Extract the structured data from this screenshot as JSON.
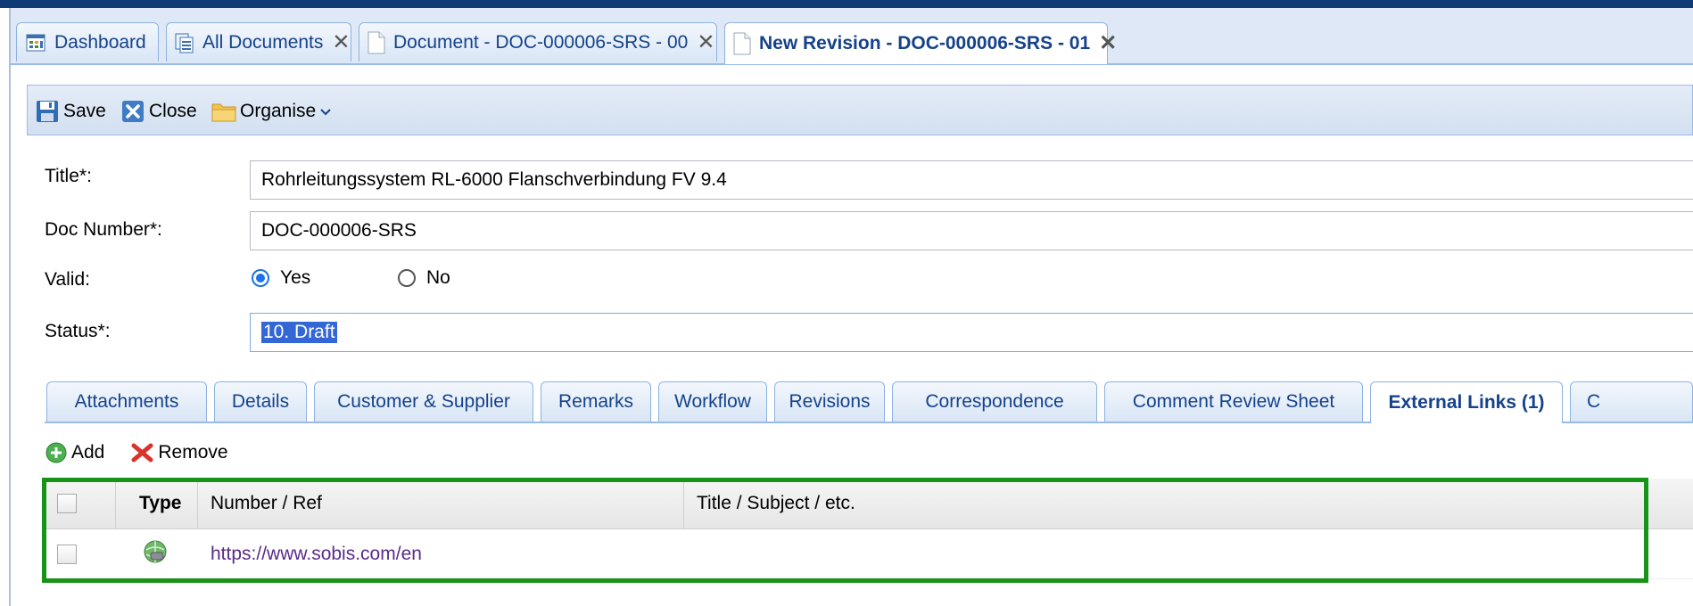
{
  "tabs": [
    {
      "label": "Dashboard",
      "icon": "dashboard-icon",
      "closable": false,
      "active": false
    },
    {
      "label": "All Documents",
      "icon": "documents-icon",
      "closable": true,
      "active": false
    },
    {
      "label": "Document - DOC-000006-SRS - 00",
      "icon": "document-icon",
      "closable": true,
      "active": false
    },
    {
      "label": "New Revision - DOC-000006-SRS - 01",
      "icon": "document-icon",
      "closable": true,
      "active": true
    }
  ],
  "toolbar": {
    "save_label": "Save",
    "close_label": "Close",
    "organise_label": "Organise"
  },
  "form": {
    "title_label": "Title*:",
    "title_value": "Rohrleitungssystem RL-6000 Flanschverbindung FV 9.4",
    "docnum_label": "Doc Number*:",
    "docnum_value": "DOC-000006-SRS",
    "valid_label": "Valid:",
    "valid_yes": "Yes",
    "valid_no": "No",
    "valid_selected": "Yes",
    "status_label": "Status*:",
    "status_value": "10. Draft"
  },
  "inner_tabs": [
    {
      "label": "Attachments",
      "active": false
    },
    {
      "label": "Details",
      "active": false
    },
    {
      "label": "Customer & Supplier",
      "active": false
    },
    {
      "label": "Remarks",
      "active": false
    },
    {
      "label": "Workflow",
      "active": false
    },
    {
      "label": "Revisions",
      "active": false
    },
    {
      "label": "Correspondence",
      "active": false
    },
    {
      "label": "Comment Review Sheet",
      "active": false
    },
    {
      "label": "External Links (1)",
      "active": true
    },
    {
      "label": "C",
      "active": false
    }
  ],
  "grid_toolbar": {
    "add_label": "Add",
    "remove_label": "Remove"
  },
  "grid": {
    "columns": [
      "Type",
      "Number / Ref",
      "Title / Subject / etc."
    ],
    "rows": [
      {
        "type_icon": "external-link-globe-icon",
        "number_ref": "https://www.sobis.com/en",
        "title": ""
      }
    ]
  },
  "colors": {
    "header_stripe": "#0f3a74",
    "tab_text": "#15428b",
    "highlight_border": "#179417",
    "selection": "#3367d6",
    "link": "#5a2a8a"
  }
}
